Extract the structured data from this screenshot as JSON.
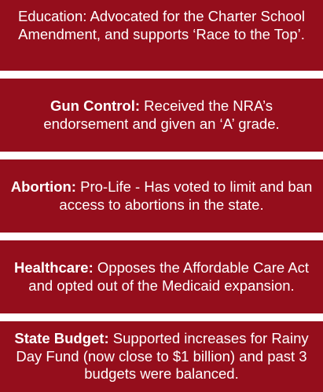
{
  "panels": [
    {
      "topic": "",
      "text": "Education: Advocated for the Charter School Amendment, and supports ‘Race to the Top’."
    },
    {
      "topic": "Gun Control:",
      "text": " Received the NRA’s endorsement and given an ‘A’ grade."
    },
    {
      "topic": "Abortion:",
      "text": " Pro-Life - Has voted to limit and ban access to abortions in the state."
    },
    {
      "topic": "Healthcare:",
      "text": " Opposes the Affordable Care Act and opted out of the Medicaid expansion."
    },
    {
      "topic": "State Budget:",
      "text": " Supported increases for Rainy Day Fund (now close to $1 billion) and past 3 budgets were balanced."
    }
  ],
  "colors": {
    "panel_background": "#950e1c",
    "text": "#ffffff",
    "gap": "#ffffff"
  }
}
